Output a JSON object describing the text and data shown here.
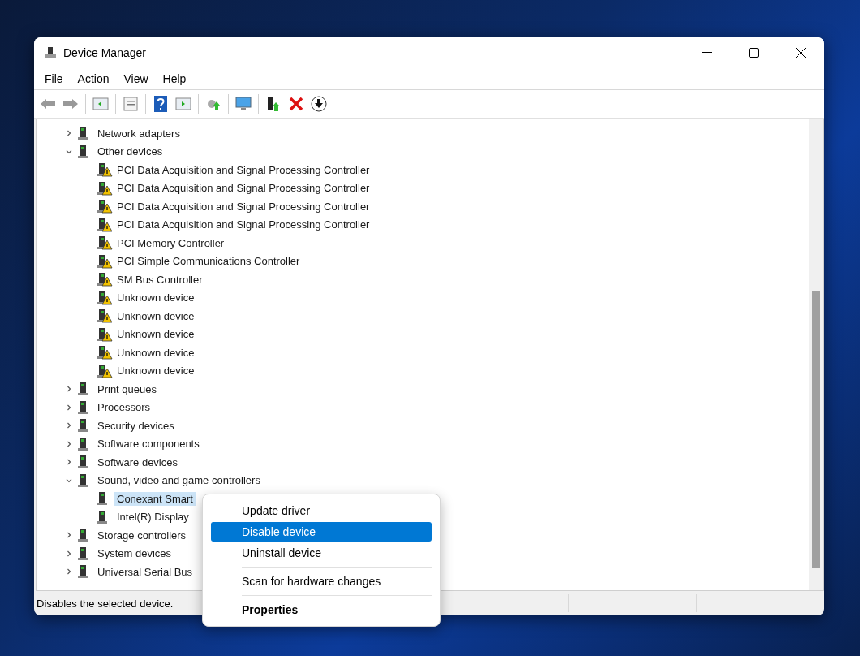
{
  "window": {
    "title": "Device Manager"
  },
  "menu": [
    "File",
    "Action",
    "View",
    "Help"
  ],
  "tree": [
    {
      "label": "Network adapters",
      "expanded": false,
      "selected": false,
      "warning": false
    },
    {
      "label": "Other devices",
      "expanded": true,
      "selected": false,
      "warning": false,
      "children": [
        {
          "label": "PCI Data Acquisition and Signal Processing Controller",
          "selected": false,
          "warning": true
        },
        {
          "label": "PCI Data Acquisition and Signal Processing Controller",
          "selected": false,
          "warning": true
        },
        {
          "label": "PCI Data Acquisition and Signal Processing Controller",
          "selected": false,
          "warning": true
        },
        {
          "label": "PCI Data Acquisition and Signal Processing Controller",
          "selected": false,
          "warning": true
        },
        {
          "label": "PCI Memory Controller",
          "selected": false,
          "warning": true
        },
        {
          "label": "PCI Simple Communications Controller",
          "selected": false,
          "warning": true
        },
        {
          "label": "SM Bus Controller",
          "selected": false,
          "warning": true
        },
        {
          "label": "Unknown device",
          "selected": false,
          "warning": true
        },
        {
          "label": "Unknown device",
          "selected": false,
          "warning": true
        },
        {
          "label": "Unknown device",
          "selected": false,
          "warning": true
        },
        {
          "label": "Unknown device",
          "selected": false,
          "warning": true
        },
        {
          "label": "Unknown device",
          "selected": false,
          "warning": true
        }
      ]
    },
    {
      "label": "Print queues",
      "expanded": false,
      "selected": false,
      "warning": false
    },
    {
      "label": "Processors",
      "expanded": false,
      "selected": false,
      "warning": false
    },
    {
      "label": "Security devices",
      "expanded": false,
      "selected": false,
      "warning": false
    },
    {
      "label": "Software components",
      "expanded": false,
      "selected": false,
      "warning": false
    },
    {
      "label": "Software devices",
      "expanded": false,
      "selected": false,
      "warning": false
    },
    {
      "label": "Sound, video and game controllers",
      "expanded": true,
      "selected": false,
      "warning": false,
      "children": [
        {
          "label": "Conexant Smart",
          "selected": true,
          "warning": false
        },
        {
          "label": "Intel(R) Display",
          "selected": false,
          "warning": false
        }
      ]
    },
    {
      "label": "Storage controllers",
      "expanded": false,
      "selected": false,
      "warning": false
    },
    {
      "label": "System devices",
      "expanded": false,
      "selected": false,
      "warning": false
    },
    {
      "label": "Universal Serial Bus",
      "expanded": false,
      "selected": false,
      "warning": false
    }
  ],
  "context_menu": [
    {
      "label": "Update driver",
      "kind": "item",
      "selected": false
    },
    {
      "label": "Disable device",
      "kind": "item",
      "selected": true
    },
    {
      "label": "Uninstall device",
      "kind": "item",
      "selected": false
    },
    {
      "kind": "separator"
    },
    {
      "label": "Scan for hardware changes",
      "kind": "item",
      "selected": false
    },
    {
      "kind": "separator"
    },
    {
      "label": "Properties",
      "kind": "default",
      "selected": false
    }
  ],
  "status_bar": "Disables the selected device."
}
